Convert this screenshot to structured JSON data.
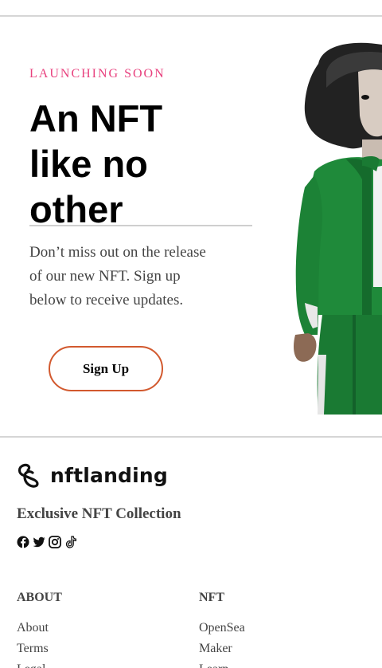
{
  "hero": {
    "eyebrow": "LAUNCHING SOON",
    "headline_lines": [
      "An NFT",
      "like no",
      "other"
    ],
    "lead_lines": [
      "Don’t miss out on the release",
      "of our new NFT. Sign up",
      "below to receive updates."
    ],
    "cta_label": "Sign Up"
  },
  "footer": {
    "brand": "nftlanding",
    "tagline": "Exclusive NFT Collection",
    "socials": [
      "facebook-icon",
      "twitter-icon",
      "instagram-icon",
      "tiktok-icon"
    ],
    "columns": [
      {
        "title": "ABOUT",
        "links": [
          "About",
          "Terms",
          "Legal"
        ]
      },
      {
        "title": "NFT",
        "links": [
          "OpenSea",
          "Maker",
          "Learn"
        ]
      }
    ]
  },
  "colors": {
    "accent_pink": "#e8417e",
    "button_border": "#d2592e",
    "rule": "#d6d6d6"
  }
}
